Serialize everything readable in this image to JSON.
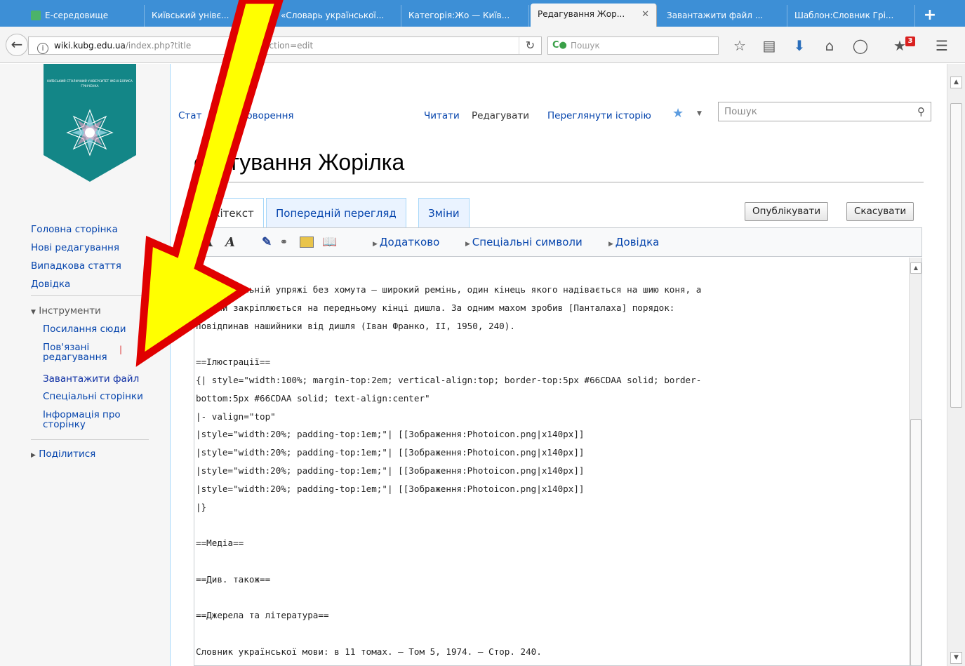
{
  "browser": {
    "tabs": [
      {
        "label": "Е-середовище"
      },
      {
        "label": "Київський унівє..."
      },
      {
        "label": "«Словарь української..."
      },
      {
        "label": "Категорія:Жо — Київ..."
      },
      {
        "label": "Редагування Жор...",
        "active": true
      },
      {
        "label": "Завантажити файл ..."
      },
      {
        "label": "Шаблон:Словник Грі..."
      }
    ],
    "url_domain": "wiki.kubg.edu.ua",
    "url_path_1": "/index.php?title",
    "url_path_2": "ка&action=edit",
    "search_placeholder": "Пошук",
    "notifications_count": "3"
  },
  "logo": {
    "text": "КИЇВСЬКИЙ СТОЛИЧНИЙ УНІВЕРСИТЕТ ІМЕНІ БОРИСА ГРІНЧЕНКА"
  },
  "sidebar": {
    "nav": [
      "Головна сторінка",
      "Нові редагування",
      "Випадкова стаття",
      "Довідка"
    ],
    "tools_heading": "Інструменти",
    "tools": [
      "Посилання сюди",
      "Пов'язані",
      "редагування",
      "Завантажити файл",
      "Спеціальні сторінки",
      "Інформація про",
      "сторінку"
    ],
    "share": "Поділитися"
  },
  "wiki": {
    "tab_article": "Стат",
    "tab_talk": "бговорення",
    "tab_read": "Читати",
    "tab_edit": "Редагувати",
    "tab_history": "Переглянути історію",
    "search_placeholder": "Пошук",
    "heading": "едагування Жорілка",
    "edit_tabs": [
      "Вікітекст",
      "Попередній перегляд",
      "Зміни"
    ],
    "publish": "Опублікувати",
    "cancel": "Скасувати",
    "toolbar_links": [
      "Додатково",
      "Спеціальні символи",
      "Довідка"
    ]
  },
  "editor_text": "2. У дишельній упряжі без хомута — широкий ремінь, один кінець якого надівається на шию коня, а\nдругий закріплюється на передньому кінці дишла. За одним махом зробив [Панталаха] порядок:\nповідпинав нашийники від дишля (Іван Франко, ІІ, 1950, 240).\n\n==Ілюстрації==\n{| style=\"width:100%; margin-top:2em; vertical-align:top; border-top:5px #66CDAA solid; border-\nbottom:5px #66CDAA solid; text-align:center\"\n|- valign=\"top\"\n|style=\"width:20%; padding-top:1em;\"| [[Зображення:Photoicon.png|x140px]]\n|style=\"width:20%; padding-top:1em;\"| [[Зображення:Photoicon.png|x140px]]\n|style=\"width:20%; padding-top:1em;\"| [[Зображення:Photoicon.png|x140px]]\n|style=\"width:20%; padding-top:1em;\"| [[Зображення:Photoicon.png|x140px]]\n|}\n\n==Медіа==\n\n==Див. також==\n\n==Джерела та література==\n\nСловник української мови: в 11 томах. — Том 5, 1974. — Стор. 240.",
  "colors": {
    "arrow_fill": "#ffff00",
    "arrow_stroke": "#e00000",
    "link": "#0645ad",
    "tab_bar": "#3d8fd6"
  }
}
